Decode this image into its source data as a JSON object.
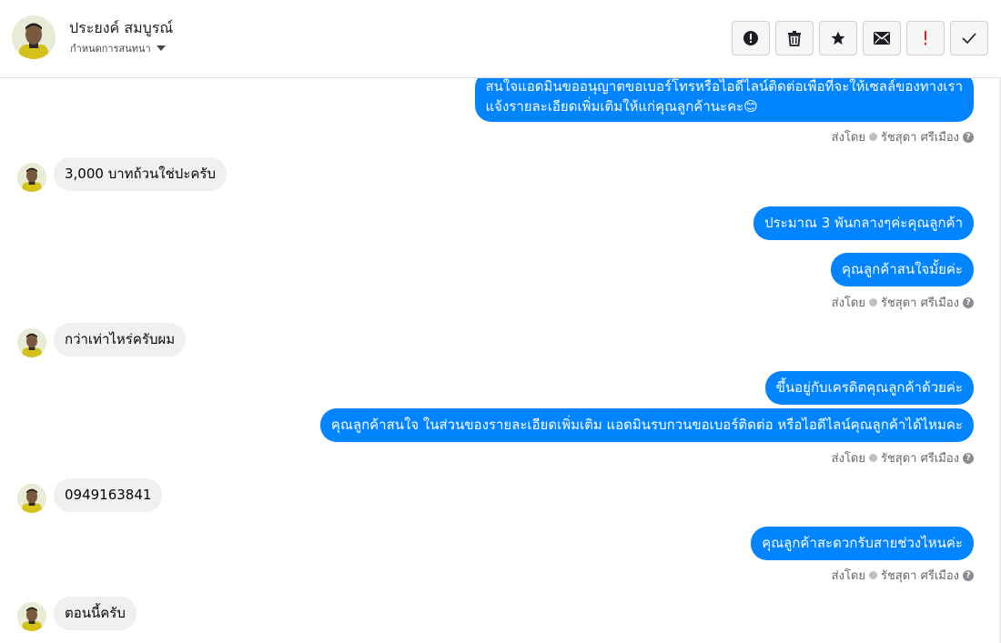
{
  "contact": {
    "name": "ประยงค์ สมบูรณ์",
    "subtitle": "กำหนดการสนทนา"
  },
  "toolbar": [
    {
      "icon": "alert-circle-icon",
      "name": "spam-button"
    },
    {
      "icon": "trash-icon",
      "name": "delete-button"
    },
    {
      "icon": "star-icon",
      "name": "star-button"
    },
    {
      "icon": "envelope-icon",
      "name": "mark-unread-button"
    },
    {
      "icon": "exclamation-icon",
      "name": "follow-up-button"
    },
    {
      "icon": "check-icon",
      "name": "done-button"
    }
  ],
  "colors": {
    "outgoing_bubble": "#0084ff",
    "incoming_bubble": "#f0f0f0",
    "follow_up_icon": "#e02020"
  },
  "sent_by": {
    "prefix": "ส่งโดย",
    "agent": "รัชสุดา ศรีเมือง"
  },
  "messages": [
    {
      "dir": "out",
      "lines": [
        "สนใจแอดมินขออนุญาตขอเบอร์โทรหรือไอดีไลน์ติดต่อเพื่อที่จะให้เซลล์ของทางเรา",
        "แจ้งรายละเอียดเพิ่มเติมให้แก่คุณลูกค้านะคะ😊"
      ]
    },
    {
      "dir": "in",
      "text": "3,000 บาทถ้วนใช่ปะครับ"
    },
    {
      "dir": "out",
      "text": "ประมาณ 3 พันกลางๆค่ะคุณลูกค้า"
    },
    {
      "dir": "out",
      "text": "คุณลูกค้าสนใจมั้ยค่ะ"
    },
    {
      "dir": "in",
      "text": "กว่าเท่าไหร่ครับผม"
    },
    {
      "dir": "out",
      "text": "ขึ้นอยู่กับเครดิตคุณลูกค้าด้วยค่ะ"
    },
    {
      "dir": "out",
      "text": "คุณลูกค้าสนใจ ในส่วนของรายละเอียดเพิ่มเติม แอดมินรบกวนขอเบอร์ติดต่อ หรือไอดีไลน์คุณลูกค้าได้ไหมคะ"
    },
    {
      "dir": "in",
      "text": "0949163841"
    },
    {
      "dir": "out",
      "text": "คุณลูกค้าสะดวกรับสายช่วงไหนค่ะ"
    },
    {
      "dir": "in",
      "text": "ตอนนี้ครับ"
    }
  ]
}
